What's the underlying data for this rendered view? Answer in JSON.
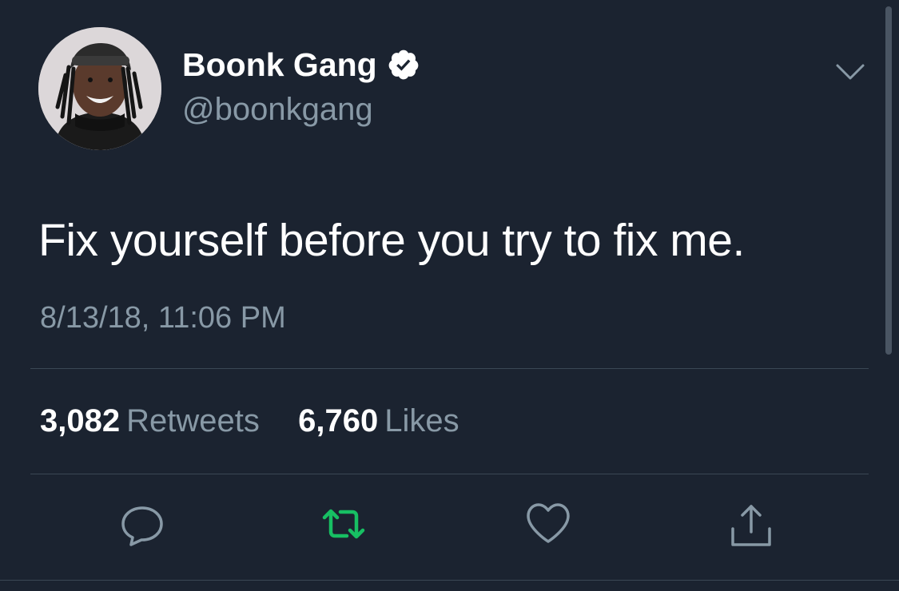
{
  "tweet": {
    "display_name": "Boonk Gang",
    "handle": "@boonkgang",
    "verified": true,
    "text": "Fix yourself before you try to fix me.",
    "timestamp": "8/13/18, 11:06 PM",
    "retweets_count": "3,082",
    "retweets_label": "Retweets",
    "likes_count": "6,760",
    "likes_label": "Likes"
  },
  "icons": {
    "menu": "chevron-down-icon",
    "verified": "verified-badge-icon",
    "reply": "reply-icon",
    "retweet": "retweet-icon",
    "like": "heart-icon",
    "share": "share-icon"
  },
  "colors": {
    "background": "#1b2330",
    "text_primary": "#ffffff",
    "text_secondary": "#8899a6",
    "retweet_active": "#17bf63",
    "divider": "#3b4754"
  }
}
